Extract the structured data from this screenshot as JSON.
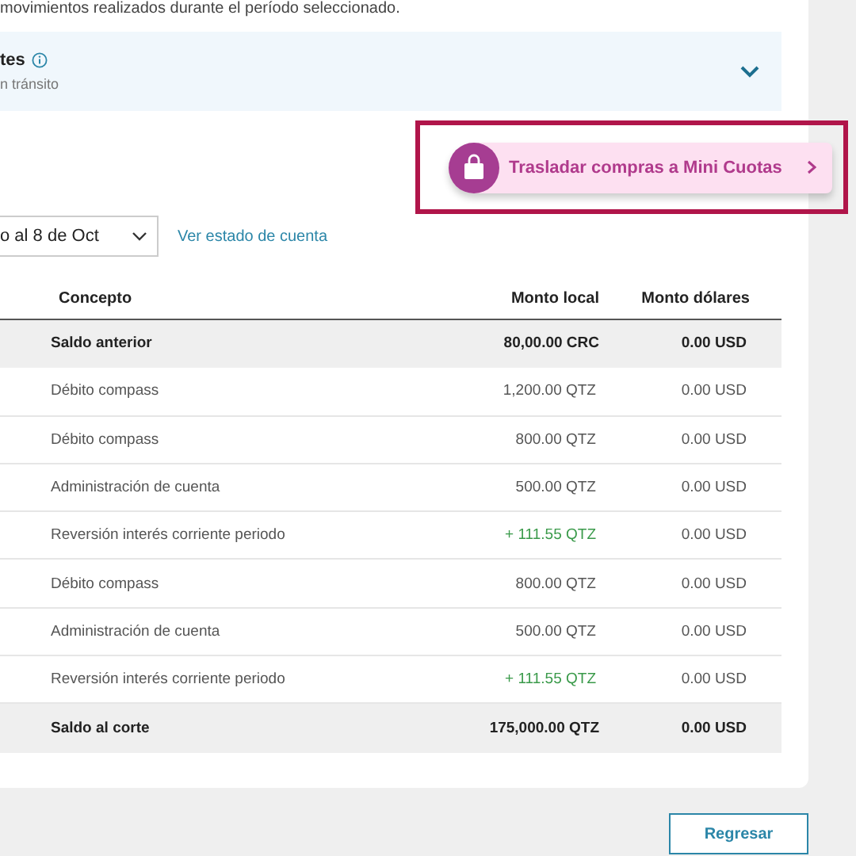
{
  "intro": "movimientos realizados durante el período seleccionado.",
  "pending": {
    "title": "tes",
    "subtitle": "n tránsito",
    "expanded": false
  },
  "promo": {
    "label": "Trasladar compras a Mini Cuotas",
    "highlighted": true
  },
  "period": {
    "value": "o al 8 de Oct"
  },
  "statement_link": "Ver estado de cuenta",
  "table": {
    "columns": [
      "Concepto",
      "Monto local",
      "Monto dólares"
    ],
    "rows": [
      {
        "kind": "total",
        "concept": "Saldo anterior",
        "local": "80,00.00 CRC",
        "usd": "0.00 USD"
      },
      {
        "kind": "debit",
        "concept": "Débito compass",
        "local": "1,200.00 QTZ",
        "usd": "0.00 USD"
      },
      {
        "kind": "debit",
        "concept": "Débito compass",
        "local": "800.00 QTZ",
        "usd": "0.00 USD"
      },
      {
        "kind": "debit",
        "concept": "Administración de cuenta",
        "local": "500.00 QTZ",
        "usd": "0.00 USD"
      },
      {
        "kind": "credit",
        "concept": "Reversión interés corriente periodo",
        "local": "+ 111.55 QTZ",
        "usd": "0.00 USD"
      },
      {
        "kind": "debit",
        "concept": "Débito compass",
        "local": "800.00 QTZ",
        "usd": "0.00 USD"
      },
      {
        "kind": "debit",
        "concept": "Administración de cuenta",
        "local": "500.00 QTZ",
        "usd": "0.00 USD"
      },
      {
        "kind": "credit",
        "concept": "Reversión interés corriente periodo",
        "local": "+ 111.55 QTZ",
        "usd": "0.00 USD"
      },
      {
        "kind": "total",
        "concept": "Saldo al corte",
        "local": "175,000.00 QTZ",
        "usd": "0.00 USD"
      }
    ]
  },
  "back_button": "Regresar"
}
